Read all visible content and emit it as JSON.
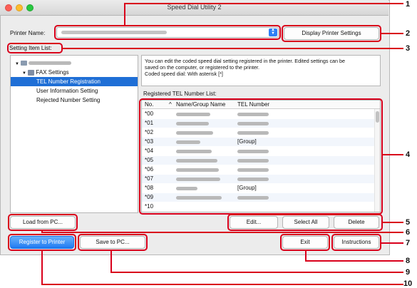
{
  "window": {
    "title": "Speed Dial Utility 2"
  },
  "printer": {
    "label": "Printer Name:",
    "display_settings_button": "Display Printer Settings"
  },
  "setting_items": {
    "label": "Setting Item List:",
    "fax_settings": "FAX Settings",
    "items": [
      "TEL Number Registration",
      "User Information Setting",
      "Rejected Number Setting"
    ]
  },
  "description": {
    "line1": "You can edit the coded speed dial setting registered in the printer. Edited settings can be",
    "line2": "saved on the computer, or registered to the printer.",
    "line3": "Coded speed dial: With asterisk [*]"
  },
  "tel_list": {
    "label": "Registered TEL Number List:",
    "columns": {
      "no": "No.",
      "sort": "^",
      "name": "Name/Group Name",
      "tel": "TEL Number"
    },
    "rows": [
      {
        "no": "*00",
        "tel": ""
      },
      {
        "no": "*01",
        "tel": ""
      },
      {
        "no": "*02",
        "tel": ""
      },
      {
        "no": "*03",
        "tel": "[Group]"
      },
      {
        "no": "*04",
        "tel": ""
      },
      {
        "no": "*05",
        "tel": ""
      },
      {
        "no": "*06",
        "tel": ""
      },
      {
        "no": "*07",
        "tel": ""
      },
      {
        "no": "*08",
        "tel": "[Group]"
      },
      {
        "no": "*09",
        "tel": ""
      },
      {
        "no": "*10",
        "tel": ""
      }
    ]
  },
  "buttons": {
    "edit": "Edit...",
    "select_all": "Select All",
    "delete": "Delete",
    "load_from_pc": "Load from PC...",
    "register_to_printer": "Register to Printer",
    "save_to_pc": "Save to PC...",
    "exit": "Exit",
    "instructions": "Instructions"
  },
  "callouts": [
    "1",
    "2",
    "3",
    "4",
    "5",
    "6",
    "7",
    "8",
    "9",
    "10"
  ],
  "colors": {
    "callout": "#d9001b",
    "selection": "#1f6fd6",
    "primary_button": "#1f7af3"
  },
  "icons": {
    "printer": "printer-icon",
    "fax": "fax-icon",
    "dropdown": "chevron-updown-icon",
    "disclosure": "disclosure-triangle-icon"
  }
}
